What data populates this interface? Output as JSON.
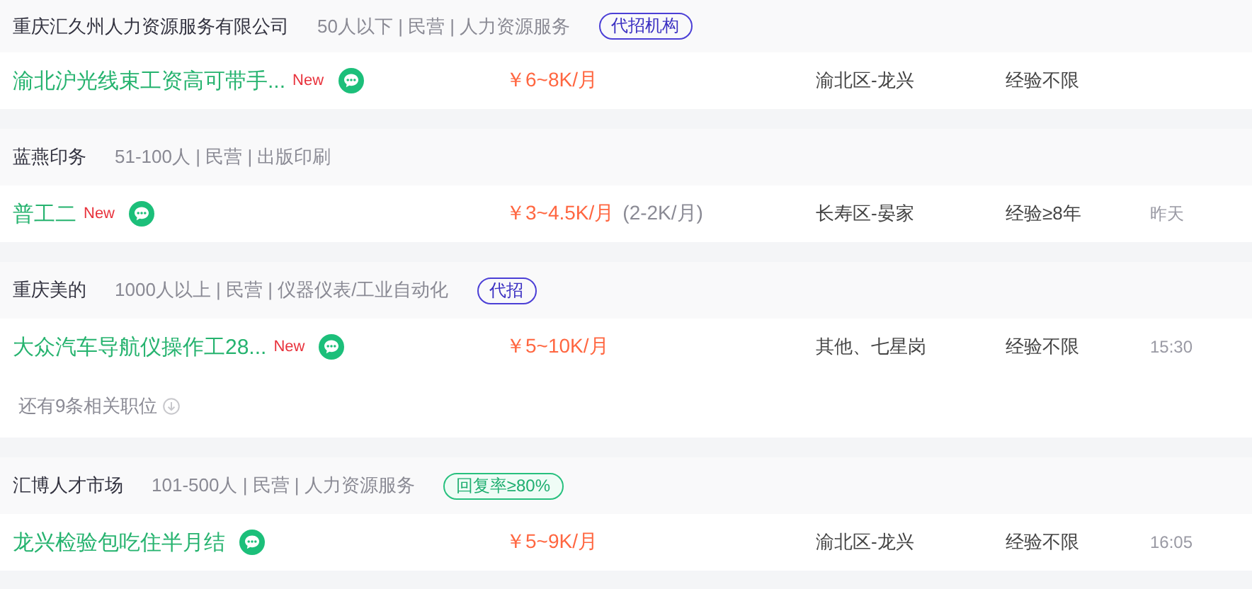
{
  "companies": [
    {
      "name": "重庆汇久州人力资源服务有限公司",
      "info": "50人以下 | 民营 | 人力资源服务",
      "badge": {
        "kind": "agency",
        "text": "代招机构"
      },
      "jobs": [
        {
          "title": "渝北沪光线束工资高可带手...",
          "new_label": "New",
          "salary": "￥6~8K/月",
          "location": "渝北区-龙兴",
          "experience": "经验不限"
        }
      ]
    },
    {
      "name": "蓝燕印务",
      "info": "51-100人 | 民营 | 出版印刷",
      "jobs": [
        {
          "title": "普工二",
          "new_label": "New",
          "salary": "￥3~4.5K/月",
          "salary_note": "(2-2K/月)",
          "location": "长寿区-晏家",
          "experience": "经验≥8年",
          "time": "昨天"
        }
      ]
    },
    {
      "name": "重庆美的",
      "info": "1000人以上 | 民营 | 仪器仪表/工业自动化",
      "badge": {
        "kind": "agency",
        "text": "代招"
      },
      "jobs": [
        {
          "title": "大众汽车导航仪操作工28...",
          "new_label": "New",
          "salary": "￥5~10K/月",
          "location": "其他、七星岗",
          "experience": "经验不限",
          "time": "15:30"
        }
      ],
      "more": "还有9条相关职位"
    },
    {
      "name": "汇博人才市场",
      "info": "101-500人 | 民营 | 人力资源服务",
      "badge": {
        "kind": "reply",
        "text": "回复率≥80%"
      },
      "jobs": [
        {
          "title": "龙兴检验包吃住半月结",
          "salary": "￥5~9K/月",
          "location": "渝北区-龙兴",
          "experience": "经验不限",
          "time": "16:05"
        }
      ]
    }
  ]
}
